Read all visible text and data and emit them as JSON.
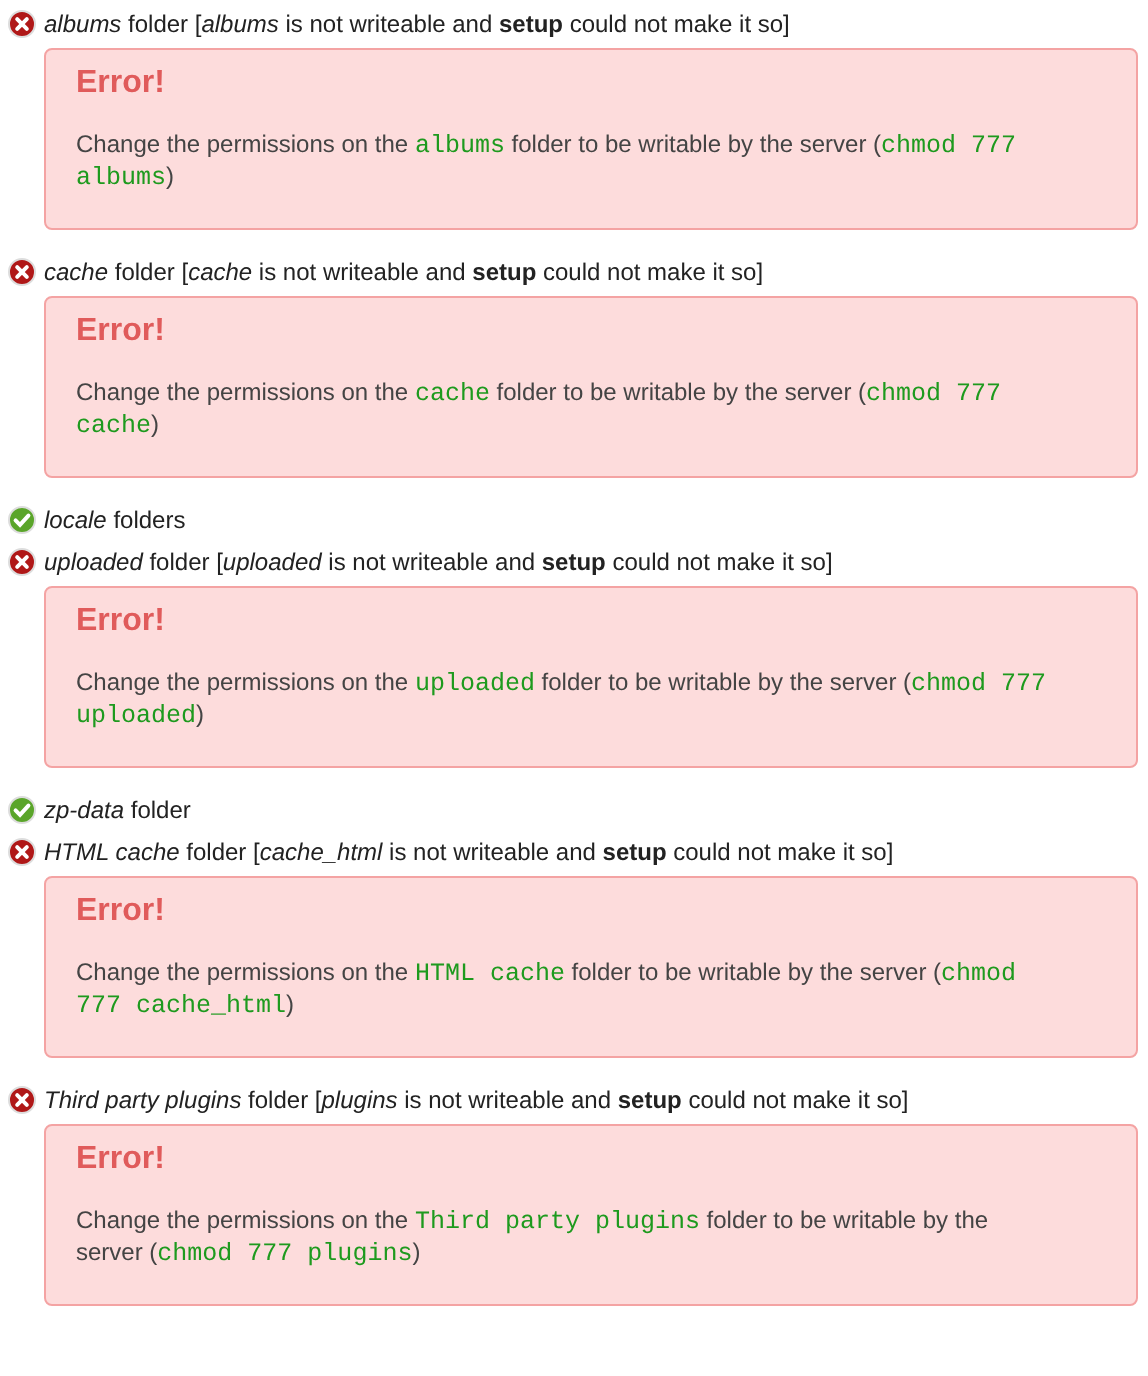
{
  "checks": [
    {
      "ok": false,
      "label": "*albums* folder [*albums* is not writeable and **setup** could not make it so]",
      "error": {
        "title": "Error!",
        "message": [
          {
            "text": "Change the permissions on the ",
            "code": false
          },
          {
            "text": "albums",
            "code": true
          },
          {
            "text": " folder to be writable by the server (",
            "code": false
          },
          {
            "text": "chmod 777 albums",
            "code": true
          },
          {
            "text": ")",
            "code": false
          }
        ]
      }
    },
    {
      "ok": false,
      "label": "*cache* folder [*cache* is not writeable and **setup** could not make it so]",
      "error": {
        "title": "Error!",
        "message": [
          {
            "text": "Change the permissions on the ",
            "code": false
          },
          {
            "text": "cache",
            "code": true
          },
          {
            "text": " folder to be writable by the server (",
            "code": false
          },
          {
            "text": "chmod 777 cache",
            "code": true
          },
          {
            "text": ")",
            "code": false
          }
        ]
      }
    },
    {
      "ok": true,
      "label": "*locale* folders"
    },
    {
      "ok": false,
      "label": "*uploaded* folder [*uploaded* is not writeable and **setup** could not make it so]",
      "error": {
        "title": "Error!",
        "message": [
          {
            "text": "Change the permissions on the ",
            "code": false
          },
          {
            "text": "uploaded",
            "code": true
          },
          {
            "text": " folder to be writable by the server (",
            "code": false
          },
          {
            "text": "chmod 777 uploaded",
            "code": true
          },
          {
            "text": ")",
            "code": false
          }
        ]
      }
    },
    {
      "ok": true,
      "label": "*zp-data* folder"
    },
    {
      "ok": false,
      "label": "*HTML cache* folder [*cache_html* is not writeable and **setup** could not make it so]",
      "error": {
        "title": "Error!",
        "message": [
          {
            "text": "Change the permissions on the ",
            "code": false
          },
          {
            "text": "HTML cache",
            "code": true
          },
          {
            "text": " folder to be writable by the server (",
            "code": false
          },
          {
            "text": "chmod 777 cache_html",
            "code": true
          },
          {
            "text": ")",
            "code": false
          }
        ]
      }
    },
    {
      "ok": false,
      "label": "*Third party plugins* folder [*plugins* is not writeable and **setup** could not make it so]",
      "error": {
        "title": "Error!",
        "message": [
          {
            "text": "Change the permissions on the ",
            "code": false
          },
          {
            "text": "Third party plugins",
            "code": true
          },
          {
            "text": " folder to be writable by the server (",
            "code": false
          },
          {
            "text": "chmod 777 plugins",
            "code": true
          },
          {
            "text": ")",
            "code": false
          }
        ]
      }
    }
  ]
}
